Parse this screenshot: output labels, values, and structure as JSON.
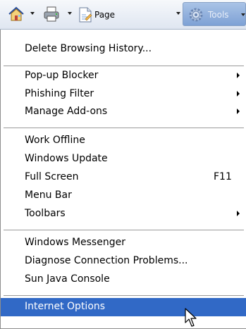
{
  "toolbar": {
    "home_icon": "home-icon",
    "print_icon": "print-icon",
    "page_label": "Page",
    "tools_label": "Tools"
  },
  "menu": {
    "delete_history": "Delete Browsing History...",
    "popup_blocker": "Pop-up Blocker",
    "phishing_filter": "Phishing Filter",
    "manage_addons": "Manage Add-ons",
    "work_offline": "Work Offline",
    "windows_update": "Windows Update",
    "full_screen": "Full Screen",
    "full_screen_shortcut": "F11",
    "menu_bar": "Menu Bar",
    "toolbars": "Toolbars",
    "windows_messenger": "Windows Messenger",
    "diagnose_connection": "Diagnose Connection Problems...",
    "sun_java_console": "Sun Java Console",
    "internet_options": "Internet Options"
  },
  "colors": {
    "highlight": "#3169c6",
    "toolbar_gradient_top": "#f6f8fb",
    "toolbar_gradient_bottom": "#dfe6f1"
  }
}
